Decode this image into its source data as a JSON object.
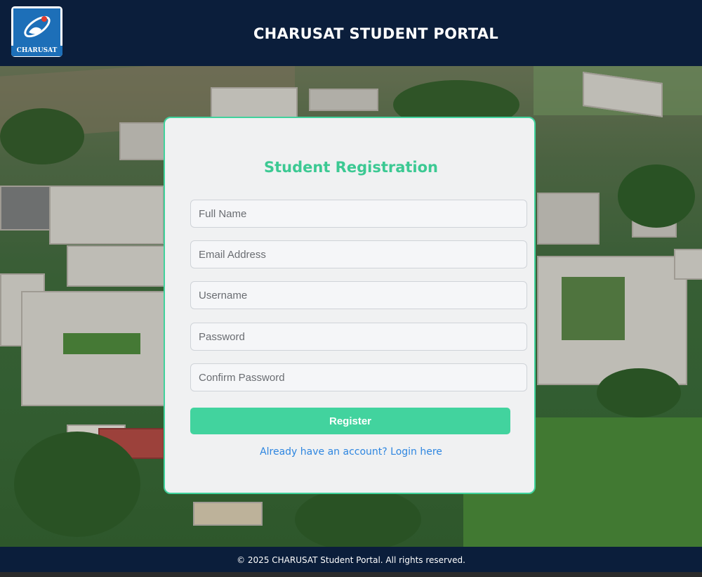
{
  "header": {
    "logo_text": "CHARUSAT",
    "title": "CHARUSAT STUDENT PORTAL"
  },
  "form": {
    "title": "Student Registration",
    "fields": [
      {
        "placeholder": "Full Name",
        "value": ""
      },
      {
        "placeholder": "Email Address",
        "value": ""
      },
      {
        "placeholder": "Username",
        "value": ""
      },
      {
        "placeholder": "Password",
        "value": ""
      },
      {
        "placeholder": "Confirm Password",
        "value": ""
      }
    ],
    "register_label": "Register",
    "login_link": "Already have an account? Login here"
  },
  "footer": {
    "text": "© 2025 CHARUSAT Student Portal. All rights reserved."
  },
  "colors": {
    "header_bg": "#0b1e3b",
    "accent": "#42d39e",
    "link": "#2e86e0"
  }
}
